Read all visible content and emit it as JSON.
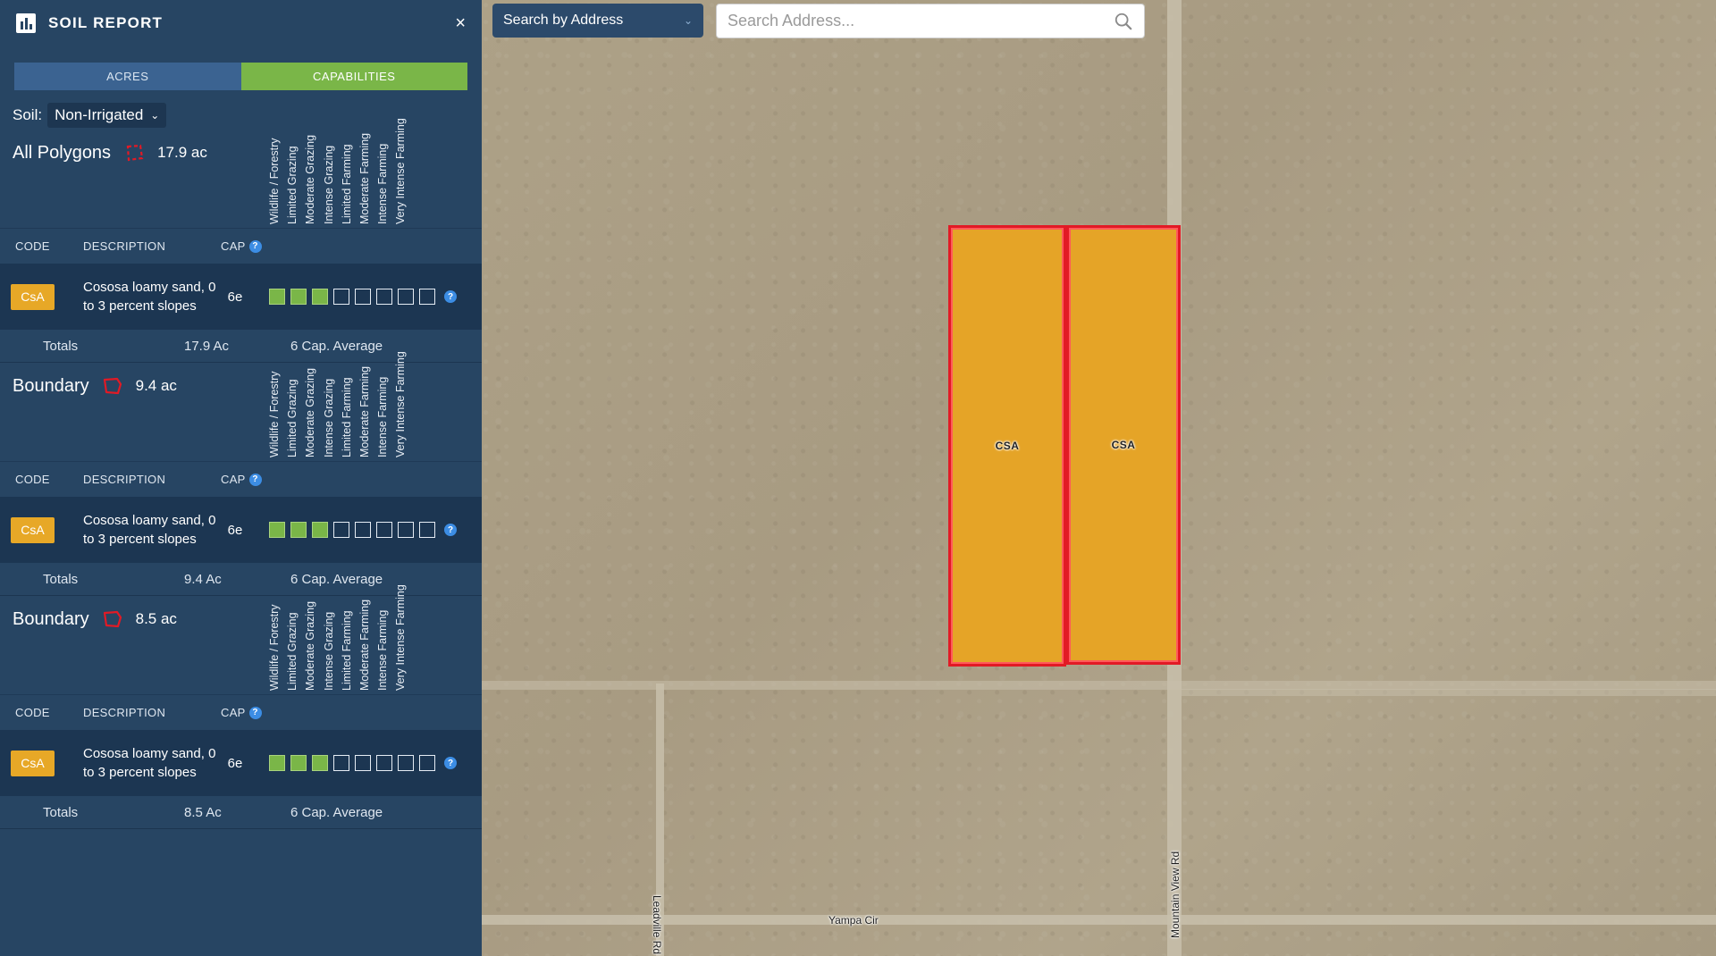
{
  "panel": {
    "title": "SOIL REPORT",
    "close": "×",
    "tabs": [
      {
        "label": "ACRES",
        "active": false
      },
      {
        "label": "CAPABILITIES",
        "active": true
      }
    ],
    "soil_label": "Soil:",
    "soil_value": "Non-Irrigated",
    "capability_columns": [
      "Wildlife / Forestry",
      "Limited Grazing",
      "Moderate Grazing",
      "Intense Grazing",
      "Limited Farming",
      "Moderate Farming",
      "Intense Farming",
      "Very Intense Farming"
    ],
    "col_code": "CODE",
    "col_description": "DESCRIPTION",
    "col_cap": "CAP",
    "groups": [
      {
        "name": "All Polygons",
        "acres": "17.9 ac",
        "row": {
          "code": "CsA",
          "description": "Cososa loamy sand, 0 to 3 percent slopes",
          "cap": "6e",
          "filled": 3
        },
        "totals": {
          "label": "Totals",
          "acres": "17.9 Ac",
          "average": "6 Cap. Average"
        }
      },
      {
        "name": "Boundary",
        "acres": "9.4 ac",
        "row": {
          "code": "CsA",
          "description": "Cososa loamy sand, 0 to 3 percent slopes",
          "cap": "6e",
          "filled": 3
        },
        "totals": {
          "label": "Totals",
          "acres": "9.4 Ac",
          "average": "6 Cap. Average"
        }
      },
      {
        "name": "Boundary",
        "acres": "8.5 ac",
        "row": {
          "code": "CsA",
          "description": "Cososa loamy sand, 0 to 3 percent slopes",
          "cap": "6e",
          "filled": 3
        },
        "totals": {
          "label": "Totals",
          "acres": "8.5 Ac",
          "average": "6 Cap. Average"
        }
      }
    ]
  },
  "search": {
    "mode": "Search by Address",
    "placeholder": "Search Address..."
  },
  "map": {
    "parcels": [
      {
        "label": "CSA"
      },
      {
        "label": "CSA"
      }
    ],
    "streets": {
      "yampa": "Yampa Cir",
      "leadville": "Leadville Rd",
      "mountain": "Mountain View Rd"
    }
  },
  "colors": {
    "panel": "#274563",
    "active_tab": "#7ab648",
    "badge": "#e7a827",
    "parcel_fill": "#e5a427",
    "parcel_border": "#e21a25"
  }
}
